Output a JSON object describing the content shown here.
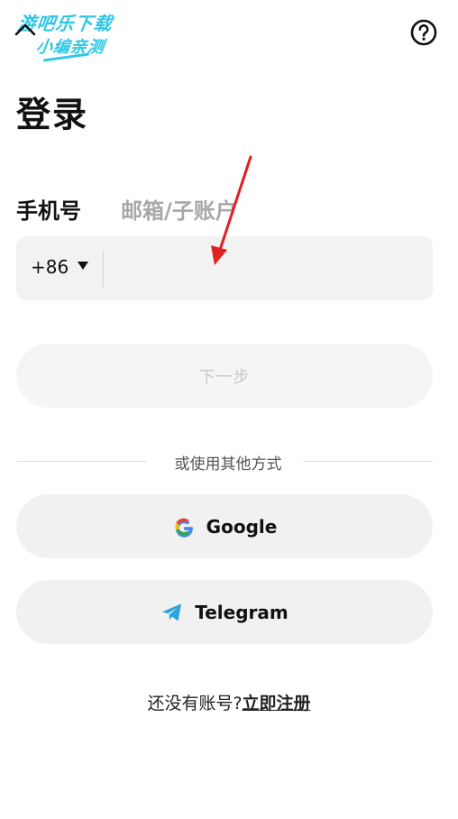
{
  "watermark": {
    "line1": "游吧乐下载",
    "line2": "小编亲测"
  },
  "icons": {
    "back": "back-chevron-icon",
    "help": "help-question-icon",
    "google": "google-icon",
    "telegram": "telegram-icon",
    "dropdown": "dropdown-triangle-icon"
  },
  "title": "登录",
  "tabs": {
    "phone": "手机号",
    "email": "邮箱/子账户"
  },
  "phone": {
    "country_code": "+86",
    "value": "",
    "placeholder": ""
  },
  "next_button": "下一步",
  "divider_text": "或使用其他方式",
  "social": {
    "google": "Google",
    "telegram": "Telegram"
  },
  "signup": {
    "prompt": "还没有账号?",
    "link": "立即注册"
  },
  "colors": {
    "accent_arrow": "#e02020",
    "watermark": "#2ec7e6",
    "telegram": "#2aa3e0",
    "disabled_text": "#c8c8c8"
  }
}
